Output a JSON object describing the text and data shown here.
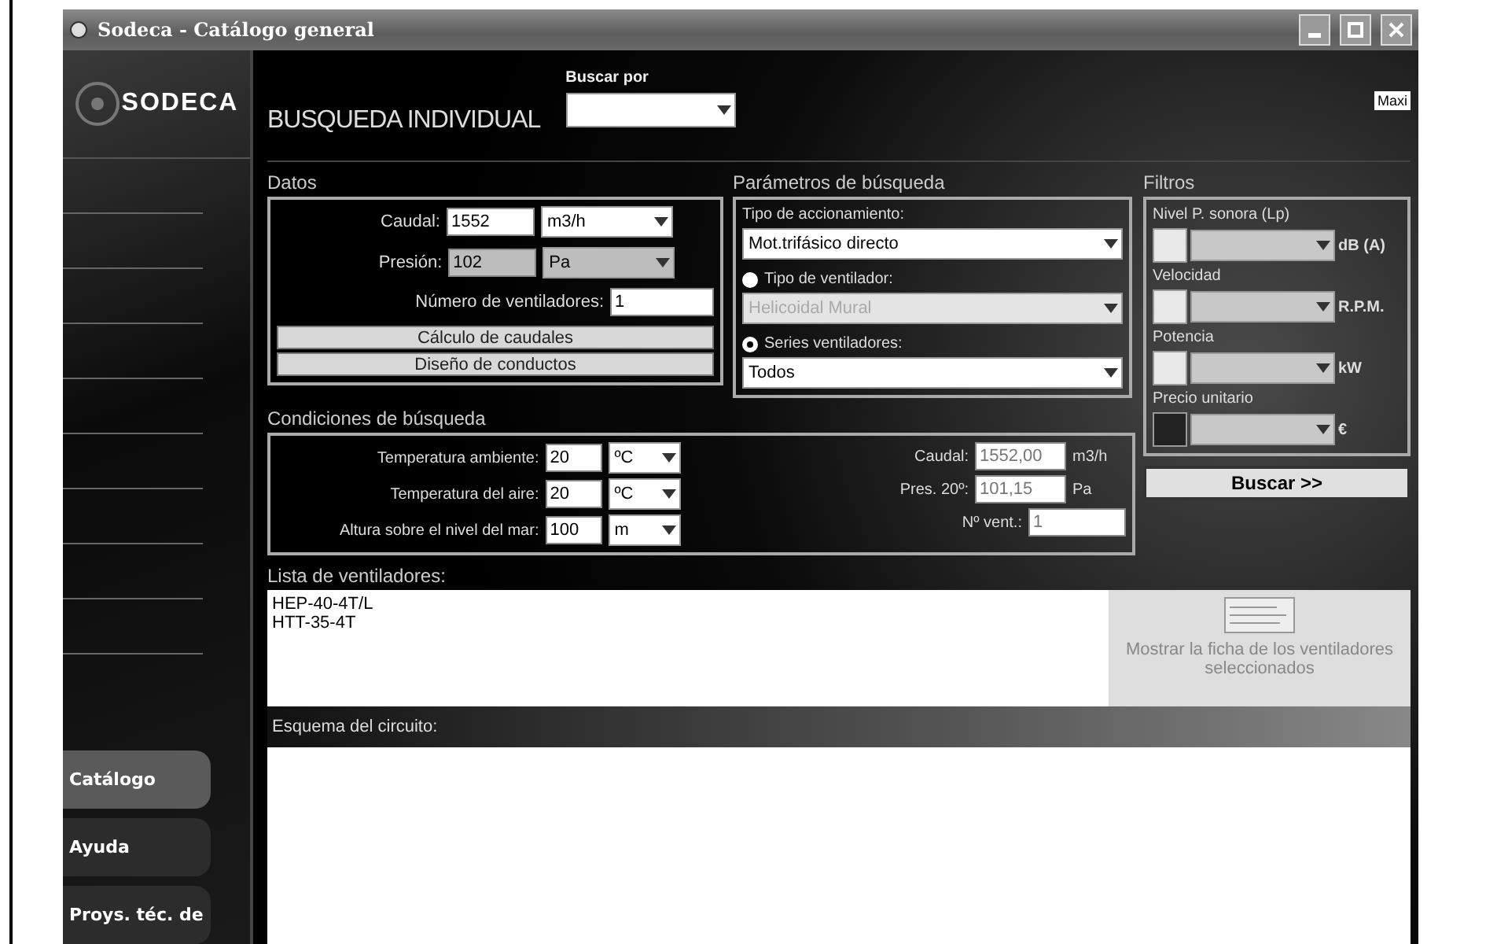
{
  "window": {
    "title": "Sodeca - Catálogo general"
  },
  "logo": {
    "text": "SODECA"
  },
  "header": {
    "title": "BUSQUEDA INDIVIDUAL",
    "search_by_label": "Buscar por",
    "corner_label": "Maxi"
  },
  "datos": {
    "title": "Datos",
    "fields": [
      {
        "label": "Caudal:",
        "value": "1552",
        "unit": "m3/h",
        "shaded": false
      },
      {
        "label": "Presión:",
        "value": "102",
        "unit": "Pa",
        "shaded": true
      }
    ],
    "fans": {
      "label": "Número de ventiladores:",
      "value": "1"
    },
    "buttons": [
      "Cálculo de caudales",
      "Diseño de conductos"
    ]
  },
  "parametros": {
    "title": "Parámetros de búsqueda",
    "drive": {
      "label": "Tipo de accionamiento:",
      "value": "Mot.trifásico directo"
    },
    "options": [
      {
        "label": "Tipo de ventilador:",
        "value": "Helicoidal Mural",
        "selected": false
      },
      {
        "label": "Series ventiladores:",
        "value": "Todos",
        "selected": true
      }
    ]
  },
  "filtros": {
    "title": "Filtros",
    "items": [
      {
        "label": "Nivel P. sonora (Lp)",
        "unit": "dB (A)",
        "checked": false
      },
      {
        "label": "Velocidad",
        "unit": "R.P.M.",
        "checked": false
      },
      {
        "label": "Potencia",
        "unit": "kW",
        "checked": false
      },
      {
        "label": "Precio unitario",
        "unit": "€",
        "checked": true
      }
    ]
  },
  "condiciones": {
    "title": "Condiciones de búsqueda",
    "rows": [
      {
        "label": "Temperatura ambiente:",
        "value": "20",
        "unit": "ºC"
      },
      {
        "label": "Temperatura del aire:",
        "value": "20",
        "unit": "ºC"
      },
      {
        "label": "Altura sobre el nivel del mar:",
        "value": "100",
        "unit": "m"
      }
    ],
    "results": [
      {
        "label": "Caudal:",
        "value": "1552,00",
        "unit": "m3/h"
      },
      {
        "label": "Pres. 20º:",
        "value": "101,15",
        "unit": "Pa"
      },
      {
        "label": "Nº vent.:",
        "value": "1"
      }
    ]
  },
  "search_button": "Buscar >>",
  "lista": {
    "title": "Lista de ventiladores:",
    "items": [
      "HEP-40-4T/L",
      "HTT-35-4T"
    ],
    "show_sheet": "Mostrar la ficha de los ventiladores seleccionados"
  },
  "esquema": {
    "title": "Esquema del circuito:"
  },
  "sidebar": {
    "items": [
      {
        "label": "Catálogo",
        "selected": true
      },
      {
        "label": "Ayuda",
        "selected": false
      },
      {
        "label": "Proys. téc. de",
        "selected": false
      }
    ]
  }
}
